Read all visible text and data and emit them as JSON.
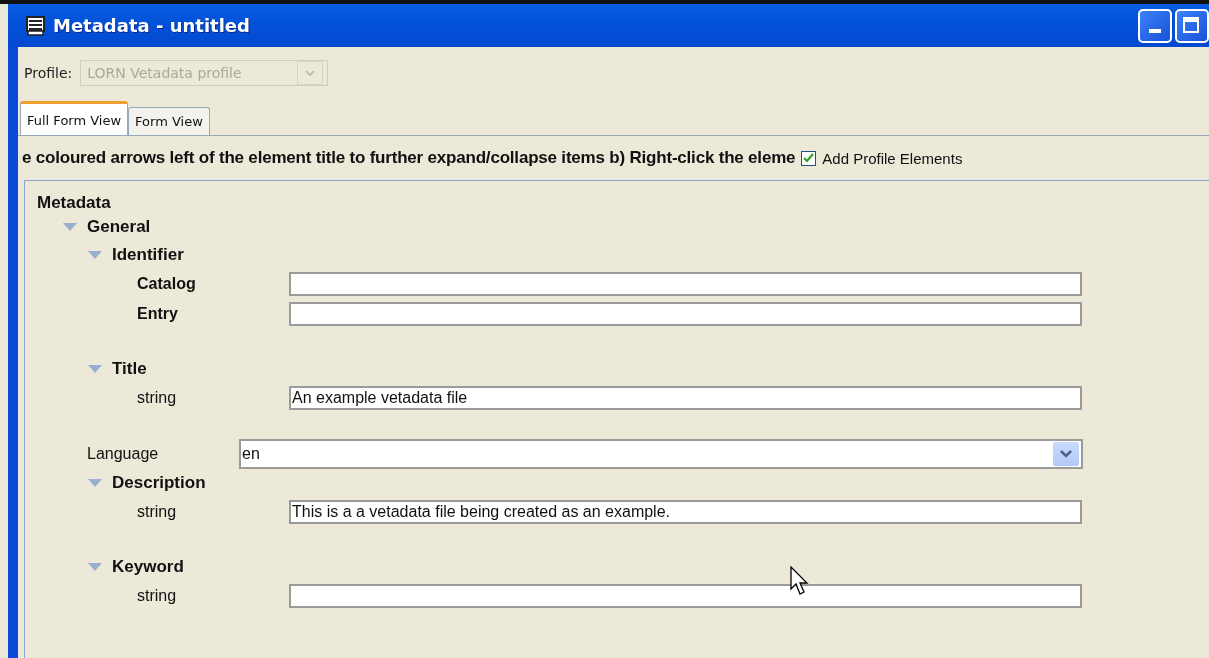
{
  "window": {
    "title": "Metadata - untitled"
  },
  "profile": {
    "label": "Profile:",
    "value": "LORN Vetadata profile",
    "disabled": true
  },
  "tabs": [
    {
      "label": "Full Form View",
      "selected": true
    },
    {
      "label": "Form View",
      "selected": false
    }
  ],
  "instructions": "e coloured arrows left of the element title to further expand/collapse items  b) Right-click the eleme",
  "add_profile_elements": {
    "label": "Add Profile Elements",
    "checked": true
  },
  "form": {
    "title": "Metadata",
    "items": [
      {
        "kind": "group",
        "label": "General",
        "expanded": true,
        "children": [
          {
            "kind": "group",
            "label": "Identifier",
            "expanded": true,
            "children": [
              {
                "kind": "element",
                "label": "Catalog"
              },
              {
                "kind": "element",
                "label": "Entry"
              }
            ]
          },
          {
            "kind": "group",
            "label": "Title",
            "expanded": true,
            "children": [
              {
                "kind": "string",
                "label": "string",
                "value": "An example vetadata file"
              }
            ]
          },
          {
            "kind": "select",
            "label": "Language",
            "value": "en"
          },
          {
            "kind": "group",
            "label": "Description",
            "expanded": true,
            "children": [
              {
                "kind": "string",
                "label": "string",
                "value": "This is a a vetadata file being created as an example."
              }
            ]
          },
          {
            "kind": "group",
            "label": "Keyword",
            "expanded": true,
            "children": [
              {
                "kind": "string",
                "label": "string"
              }
            ]
          }
        ]
      }
    ]
  }
}
